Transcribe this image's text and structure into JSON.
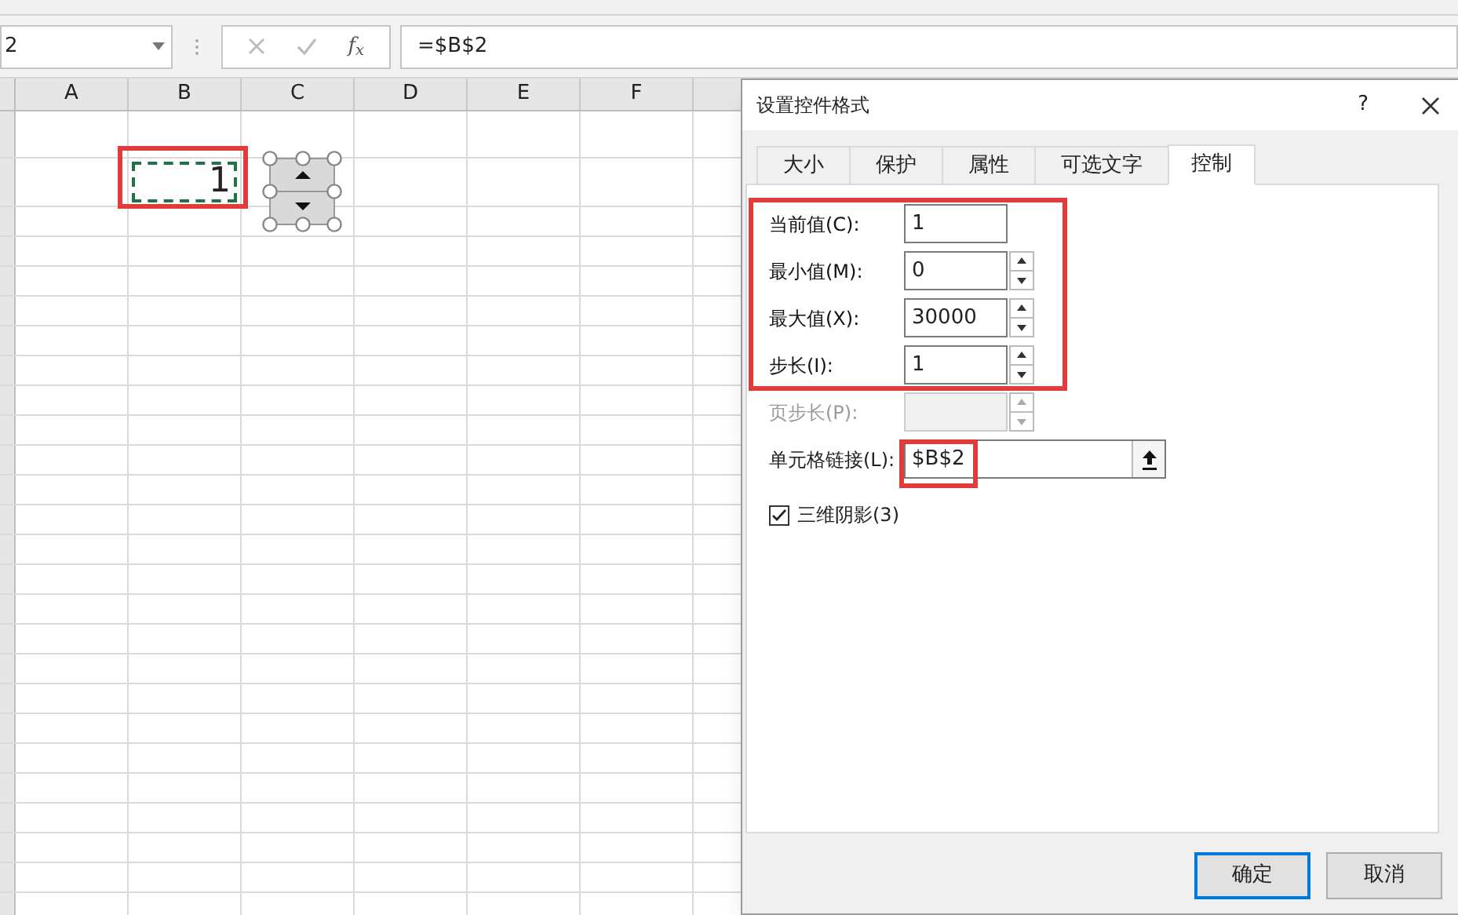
{
  "formula_bar": {
    "name_box": "2",
    "fx_label": "f$_{x}$",
    "formula": "=$B$2"
  },
  "sheet": {
    "columns": [
      "A",
      "B",
      "C",
      "D",
      "E",
      "F"
    ],
    "linked_cell": {
      "value": "1",
      "highlighted": true
    }
  },
  "dialog": {
    "title": "设置控件格式",
    "help": "?",
    "tabs": [
      {
        "label": "大小",
        "selected": false
      },
      {
        "label": "保护",
        "selected": false
      },
      {
        "label": "属性",
        "selected": false
      },
      {
        "label": "可选文字",
        "selected": false
      },
      {
        "label": "控制",
        "selected": true
      }
    ],
    "fields_highlighted": true,
    "fields": [
      {
        "kind": "text",
        "label": "当前值(C):",
        "value": "1",
        "disabled": false
      },
      {
        "kind": "spin",
        "label": "最小值(M):",
        "value": "0",
        "disabled": false
      },
      {
        "kind": "spin",
        "label": "最大值(X):",
        "value": "30000",
        "disabled": false
      },
      {
        "kind": "spin",
        "label": "步长(I):",
        "value": "1",
        "disabled": false
      },
      {
        "kind": "spin",
        "label": "页步长(P):",
        "disabled": true
      }
    ],
    "cell_link": {
      "label": "单元格链接(L):",
      "value": "$B$2",
      "highlighted": true
    },
    "shading": {
      "label": "三维阴影(3)",
      "checked": true
    },
    "buttons": [
      {
        "label": "确定",
        "default": true
      },
      {
        "label": "取消",
        "default": false
      }
    ]
  }
}
